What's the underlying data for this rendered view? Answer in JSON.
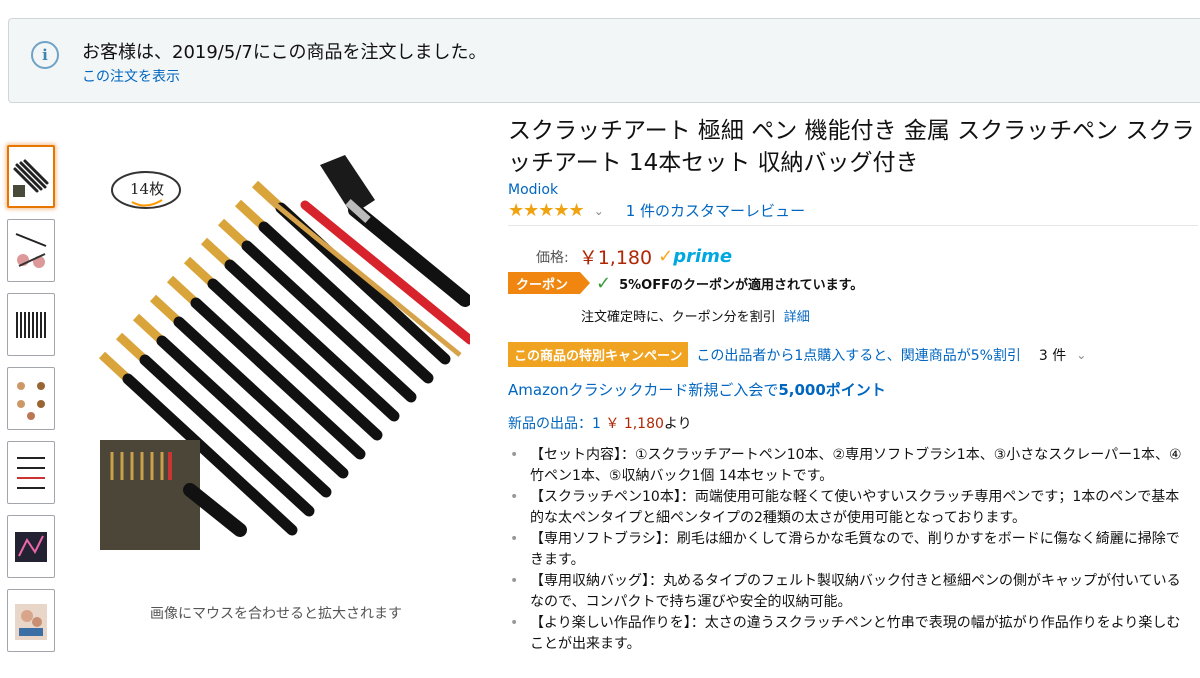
{
  "notice": {
    "message": "お客様は、2019/5/7にこの商品を注文しました。",
    "view_order_link": "この注文を表示",
    "icon": "info-icon"
  },
  "image": {
    "badge_text": "14枚",
    "hover_hint": "画像にマウスを合わせると拡大されます"
  },
  "product": {
    "title": "スクラッチアート 極細 ペン 機能付き 金属 スクラッチペン スクラッチアート 14本セット 収納バッグ付き",
    "brand": "Modiok",
    "stars": "★★★★★",
    "rating": 5,
    "review_link": "1 件のカスタマーレビュー",
    "price_label": "価格:",
    "price": "￥1,180",
    "prime_label": "prime",
    "coupon_badge": "クーポン",
    "coupon_text": "5%OFFのクーポンが適用されています。",
    "coupon_note": "注文確定時に、クーポン分を割引",
    "coupon_detail_link": "詳細",
    "campaign_badge": "この商品の特別キャンペーン",
    "campaign_text": "この出品者から1点購入すると、関連商品が5%割引",
    "campaign_count": "3 件",
    "card_offer_prefix": "Amazonクラシックカード新規ご入会で",
    "card_offer_points": "5,000ポイント",
    "new_offers_link": "新品の出品：1",
    "new_offers_price": "￥ 1,180",
    "new_offers_suffix": "より",
    "bullets": [
      "【セット内容】：①スクラッチアートペン10本、②専用ソフトブラシ1本、③小さなスクレーパー1本、④竹ペン1本、⑤収納バック1個 14本セットです。",
      "【スクラッチペン10本】：両端使用可能な軽くて使いやすいスクラッチ専用ペンです；1本のペンで基本的な太ペンタイプと細ペンタイプの2種類の太さが使用可能となっております。",
      "【専用ソフトブラシ】：刷毛は細かくして滑らかな毛質なので、削りかすをボードに傷なく綺麗に掃除できます。",
      "【専用収納バッグ】：丸めるタイプのフェルト製収納バック付きと極細ペンの側がキャップが付いているなので、コンパクトで持ち運びや安全的収納可能。",
      "【より楽しい作品作りを】：太さの違うスクラッチペンと竹串で表現の幅が拡がり作品作りをより楽しむことが出来ます。"
    ]
  },
  "colors": {
    "link": "#0066c0",
    "price": "#b12704",
    "coupon": "#f0860f",
    "campaign": "#f0a321",
    "star": "#f0a311"
  }
}
